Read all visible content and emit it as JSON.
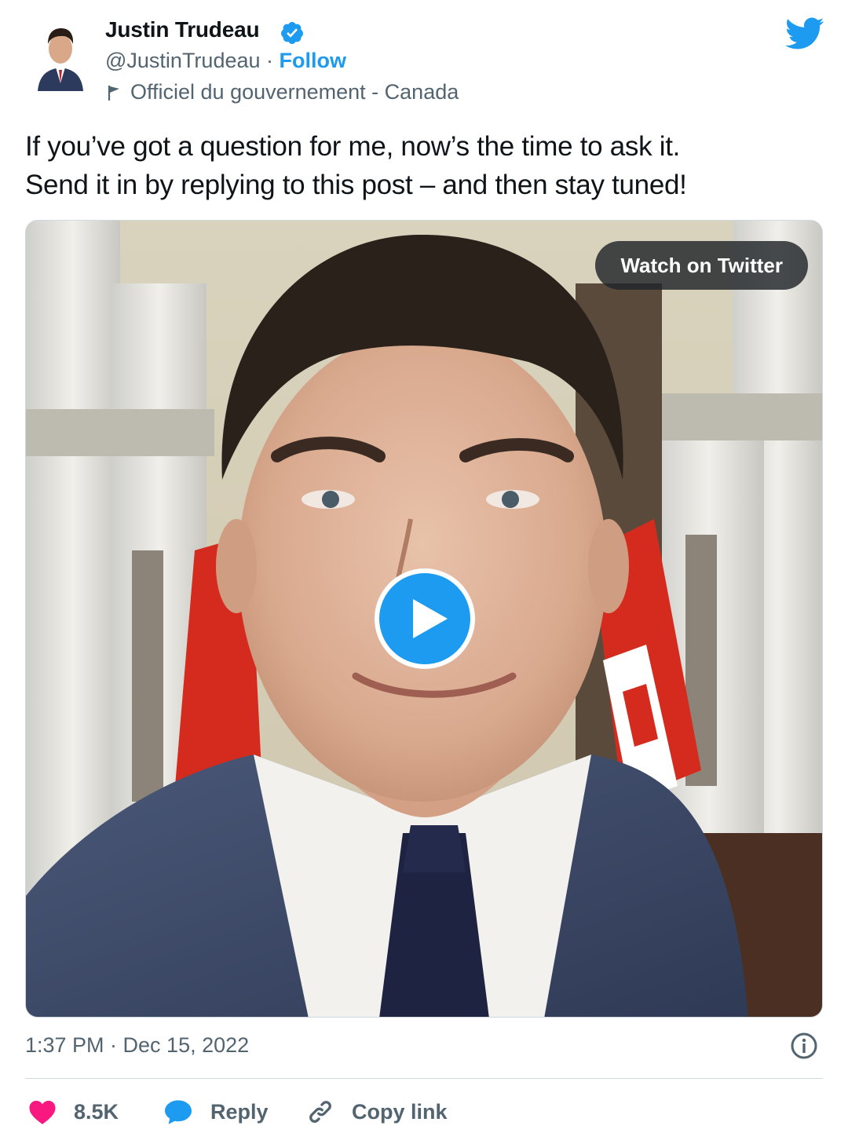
{
  "author": {
    "name": "Justin Trudeau",
    "handle": "@JustinTrudeau",
    "separator": "·",
    "follow_label": "Follow",
    "account_label": "Officiel du gouvernement - Canada"
  },
  "tweet": {
    "text_line1": "If you’ve got a question for me, now’s the time to ask it.",
    "text_line2": "Send it in by replying to this post – and then stay tuned!",
    "timestamp": "1:37 PM · Dec 15, 2022"
  },
  "media": {
    "watch_label": "Watch on Twitter"
  },
  "actions": {
    "like_count": "8.5K",
    "reply_label": "Reply",
    "copy_label": "Copy link"
  },
  "colors": {
    "accent": "#1d9bf0",
    "like": "#f91880",
    "secondary_text": "#536471",
    "flag_red": "#d52b1e"
  },
  "icons": [
    "verified-badge-icon",
    "twitter-bird-icon",
    "government-flag-icon",
    "play-icon",
    "info-icon",
    "heart-icon",
    "reply-bubble-icon",
    "link-icon"
  ]
}
